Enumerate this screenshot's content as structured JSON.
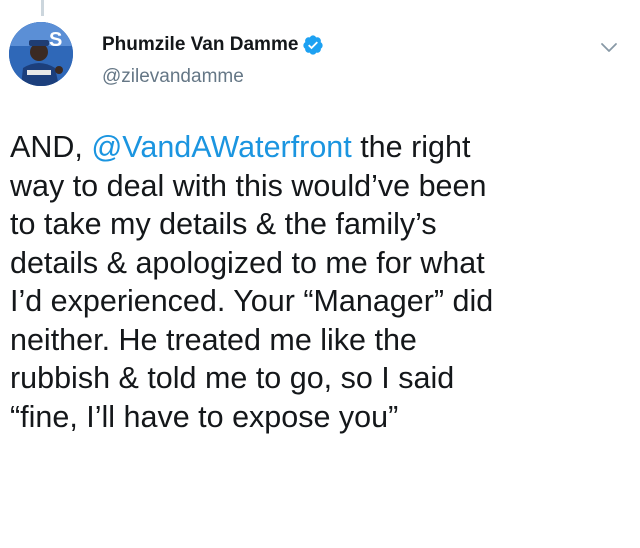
{
  "author": {
    "display_name": "Phumzile Van Damme",
    "handle": "@zilevandamme",
    "verified": true,
    "avatar_icon": "profile-photo",
    "verified_icon": "verified-badge-icon"
  },
  "tweet": {
    "lines": [
      {
        "prefix": "AND, ",
        "mention": "@VandAWaterfront",
        "suffix": " the right"
      },
      {
        "text": "way to deal with this would’ve been"
      },
      {
        "text": "to take my details & the family’s"
      },
      {
        "text": "details & apologized to me for what"
      },
      {
        "text": "I’d experienced. Your “Manager” did"
      },
      {
        "text": "neither. He treated me like the"
      },
      {
        "text": "rubbish & told me to go, so I said"
      },
      {
        "text": "“fine, I’ll have to expose you”"
      }
    ]
  },
  "colors": {
    "link": "#1b95e0",
    "verified": "#1da1f2",
    "text": "#14171a",
    "secondary": "#657786"
  }
}
